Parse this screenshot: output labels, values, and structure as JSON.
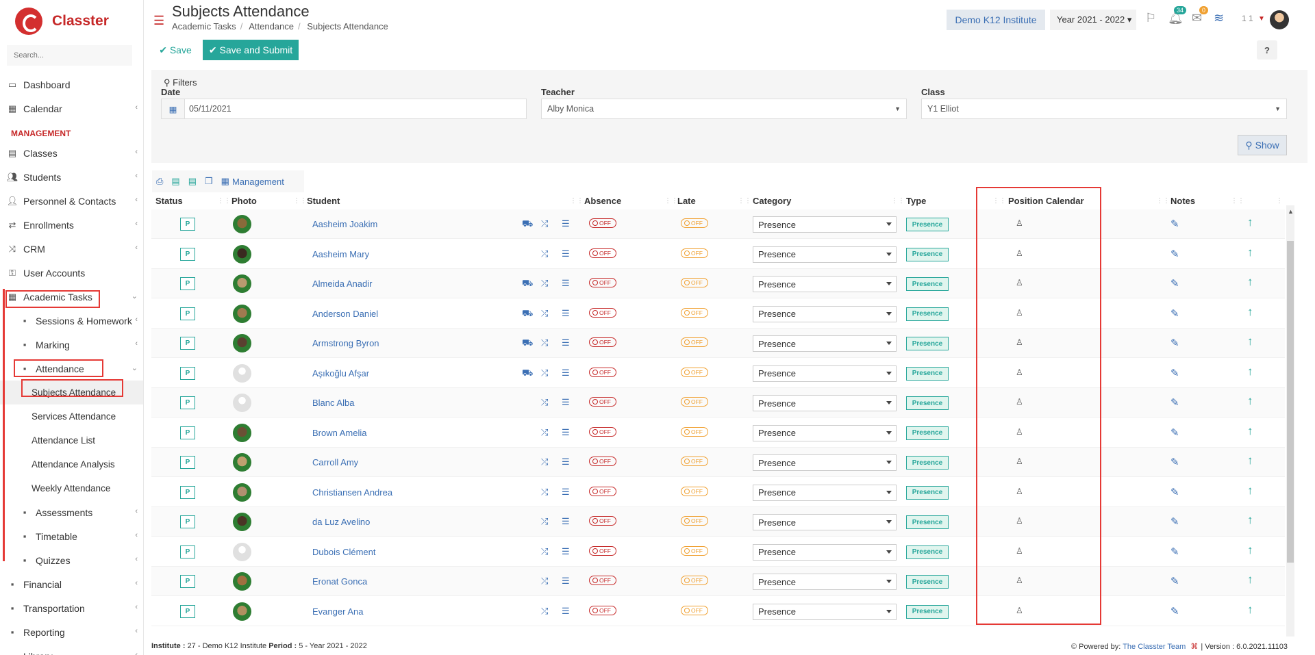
{
  "brand": {
    "name": "Classter"
  },
  "sidebar": {
    "search_placeholder": "Search...",
    "items": [
      {
        "label": "Dashboard",
        "icon": "laptop-icon"
      },
      {
        "label": "Calendar",
        "icon": "calendar-icon"
      }
    ],
    "section_header": "MANAGEMENT",
    "mgmt_items": [
      {
        "label": "Classes",
        "icon": "classes-icon"
      },
      {
        "label": "Students",
        "icon": "students-icon"
      },
      {
        "label": "Personnel & Contacts",
        "icon": "person-icon"
      },
      {
        "label": "Enrollments",
        "icon": "exchange-icon"
      },
      {
        "label": "CRM",
        "icon": "crm-icon"
      },
      {
        "label": "User Accounts",
        "icon": "key-icon"
      },
      {
        "label": "Academic Tasks",
        "icon": "grid-icon"
      }
    ],
    "academic_items": [
      {
        "label": "Sessions & Homework"
      },
      {
        "label": "Marking"
      },
      {
        "label": "Attendance"
      }
    ],
    "attendance_items": [
      {
        "label": "Subjects Attendance"
      },
      {
        "label": "Services Attendance"
      },
      {
        "label": "Attendance List"
      },
      {
        "label": "Attendance Analysis"
      },
      {
        "label": "Weekly Attendance"
      }
    ],
    "more_items": [
      {
        "label": "Assessments"
      },
      {
        "label": "Timetable"
      },
      {
        "label": "Quizzes"
      },
      {
        "label": "Financial"
      },
      {
        "label": "Transportation"
      },
      {
        "label": "Reporting"
      },
      {
        "label": "Library"
      }
    ]
  },
  "header": {
    "title": "Subjects Attendance",
    "breadcrumb": [
      "Academic Tasks",
      "Attendance",
      "Subjects Attendance"
    ],
    "institute": "Demo K12 Institute",
    "year": "Year 2021 - 2022",
    "notif_count": "34",
    "mail_count": "0",
    "user_short": "1 1"
  },
  "toolbar": {
    "save": "Save",
    "save_submit": "Save and Submit",
    "help": "?"
  },
  "filters": {
    "title": "Filters",
    "date_label": "Date",
    "date_value": "05/11/2021",
    "teacher_label": "Teacher",
    "teacher_value": "Alby Monica",
    "class_label": "Class",
    "class_value": "Y1 Elliot",
    "show": "Show"
  },
  "table_tools": {
    "management": "Management"
  },
  "columns": {
    "status": "Status",
    "photo": "Photo",
    "student": "Student",
    "absence": "Absence",
    "late": "Late",
    "category": "Category",
    "type": "Type",
    "position_calendar": "Position Calendar",
    "notes": "Notes"
  },
  "rows": [
    {
      "status": "P",
      "name": "Aasheim Joakim",
      "bus": true,
      "absence": "OFF",
      "late": "OFF",
      "category": "Presence",
      "type": "Presence",
      "photo": "#8a6a3a"
    },
    {
      "status": "P",
      "name": "Aasheim Mary",
      "bus": false,
      "absence": "OFF",
      "late": "OFF",
      "category": "Presence",
      "type": "Presence",
      "photo": "#3a2a20"
    },
    {
      "status": "P",
      "name": "Almeida Anadir",
      "bus": true,
      "absence": "OFF",
      "late": "OFF",
      "category": "Presence",
      "type": "Presence",
      "photo": "#b89a70"
    },
    {
      "status": "P",
      "name": "Anderson Daniel",
      "bus": true,
      "absence": "OFF",
      "late": "OFF",
      "category": "Presence",
      "type": "Presence",
      "photo": "#a07a50"
    },
    {
      "status": "P",
      "name": "Armstrong Byron",
      "bus": true,
      "absence": "OFF",
      "late": "OFF",
      "category": "Presence",
      "type": "Presence",
      "photo": "#5a4030"
    },
    {
      "status": "P",
      "name": "Aşıkoğlu Afşar",
      "bus": true,
      "absence": "OFF",
      "late": "OFF",
      "category": "Presence",
      "type": "Presence",
      "photo": "#e0e0e0"
    },
    {
      "status": "P",
      "name": "Blanc Alba",
      "bus": false,
      "absence": "OFF",
      "late": "OFF",
      "category": "Presence",
      "type": "Presence",
      "photo": "#e0e0e0"
    },
    {
      "status": "P",
      "name": "Brown Amelia",
      "bus": false,
      "absence": "OFF",
      "late": "OFF",
      "category": "Presence",
      "type": "Presence",
      "photo": "#6a5035"
    },
    {
      "status": "P",
      "name": "Carroll Amy",
      "bus": false,
      "absence": "OFF",
      "late": "OFF",
      "category": "Presence",
      "type": "Presence",
      "photo": "#c0a070"
    },
    {
      "status": "P",
      "name": "Christiansen Andrea",
      "bus": false,
      "absence": "OFF",
      "late": "OFF",
      "category": "Presence",
      "type": "Presence",
      "photo": "#b09070"
    },
    {
      "status": "P",
      "name": "da Luz Avelino",
      "bus": false,
      "absence": "OFF",
      "late": "OFF",
      "category": "Presence",
      "type": "Presence",
      "photo": "#4a3525"
    },
    {
      "status": "P",
      "name": "Dubois Clément",
      "bus": false,
      "absence": "OFF",
      "late": "OFF",
      "category": "Presence",
      "type": "Presence",
      "photo": "#e0e0e0"
    },
    {
      "status": "P",
      "name": "Eronat Gonca",
      "bus": false,
      "absence": "OFF",
      "late": "OFF",
      "category": "Presence",
      "type": "Presence",
      "photo": "#a07040"
    },
    {
      "status": "P",
      "name": "Evanger Ana",
      "bus": false,
      "absence": "OFF",
      "late": "OFF",
      "category": "Presence",
      "type": "Presence",
      "photo": "#b09060"
    }
  ],
  "footer": {
    "institute_label": "Institute :",
    "institute_value": "27 - Demo K12 Institute",
    "period_label": "Period :",
    "period_value": "5 - Year 2021 - 2022",
    "powered_by": "Powered by:",
    "team": "The Classter Team",
    "version": "Version : 6.0.2021.11103"
  },
  "colors": {
    "brand": "#c62828",
    "accent": "#26a69a",
    "link": "#3b6fb4",
    "highlight": "#e53935"
  }
}
